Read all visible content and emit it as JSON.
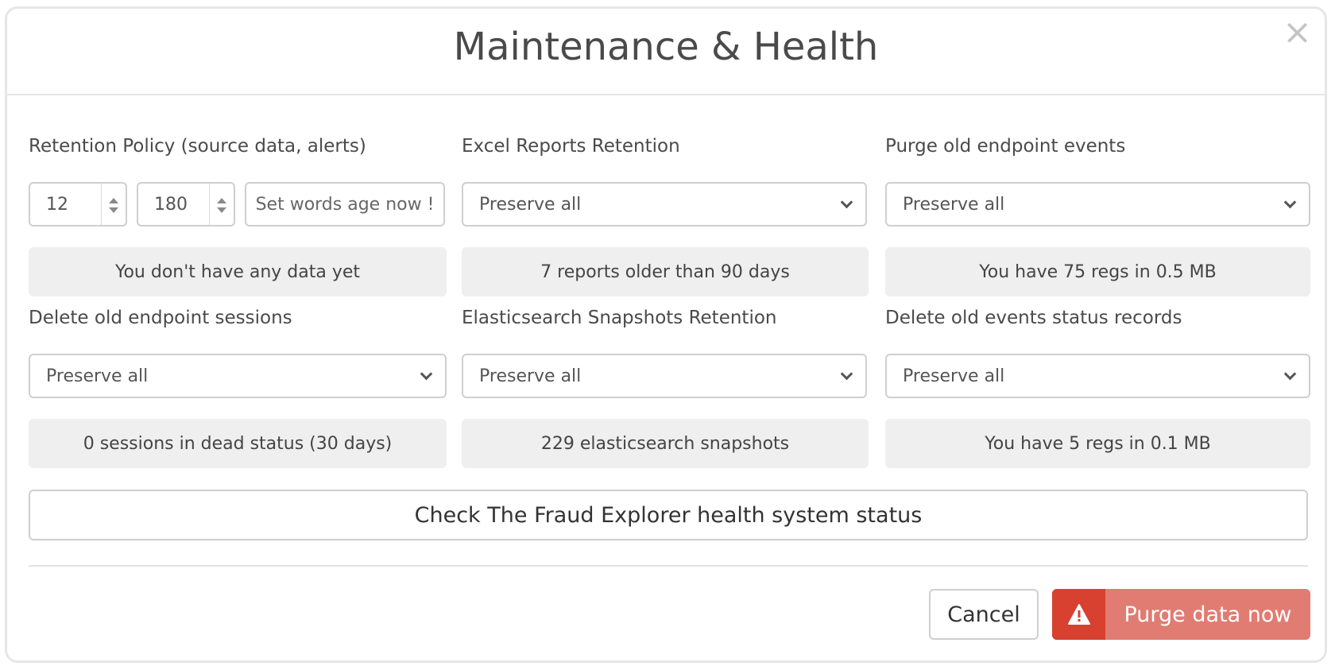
{
  "modal": {
    "title": "Maintenance & Health",
    "close_glyph": "×"
  },
  "retention": {
    "label": "Retention Policy (source data, alerts)",
    "months_value": "12",
    "days_value": "180",
    "set_words_button": "Set words age now !",
    "status": "You don't have any data yet"
  },
  "excel_reports": {
    "label": "Excel Reports Retention",
    "selected": "Preserve all",
    "status": "7 reports older than 90 days"
  },
  "purge_endpoint_events": {
    "label": "Purge old endpoint events",
    "selected": "Preserve all",
    "status": "You have 75 regs in 0.5 MB"
  },
  "endpoint_sessions": {
    "label": "Delete old endpoint sessions",
    "selected": "Preserve all",
    "status": "0 sessions in dead status (30 days)"
  },
  "es_snapshots": {
    "label": "Elasticsearch Snapshots Retention",
    "selected": "Preserve all",
    "status": "229 elasticsearch snapshots"
  },
  "events_status": {
    "label": "Delete old events status records",
    "selected": "Preserve all",
    "status": "You have 5 regs in 0.1 MB"
  },
  "health_button": "Check The Fraud Explorer health system status",
  "footer": {
    "cancel": "Cancel",
    "purge": "Purge data now"
  },
  "icons": {
    "warning": "warning-triangle-icon",
    "close": "close-icon",
    "chevron": "chevron-down-icon"
  },
  "colors": {
    "danger_dark": "#d8402f",
    "danger_light": "#e17c72",
    "info_bg": "#efefef"
  }
}
